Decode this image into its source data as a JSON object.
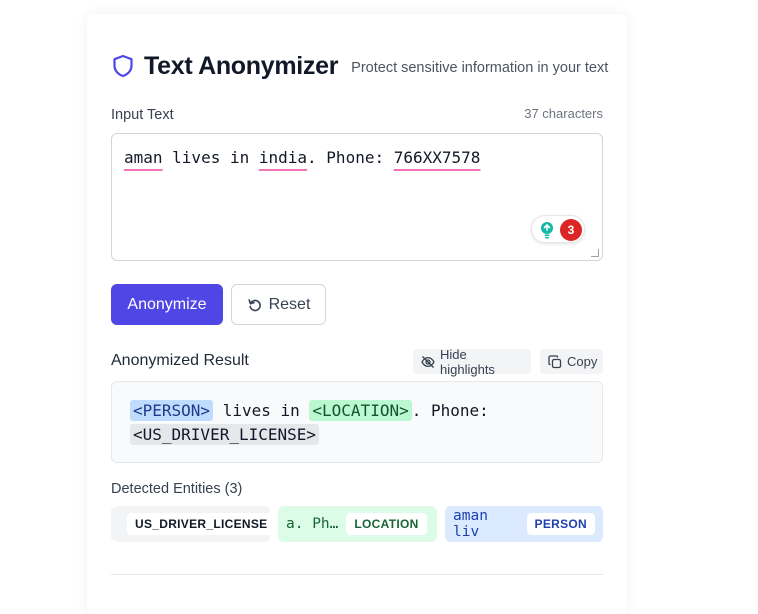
{
  "header": {
    "title": "Text Anonymizer",
    "subtitle": "Protect sensitive information in your text",
    "icon": "shield-icon"
  },
  "input": {
    "label": "Input Text",
    "char_count": "37 characters",
    "segments": [
      "aman",
      " lives in ",
      "india",
      ". Phone: ",
      "766XX7578"
    ]
  },
  "grammarly": {
    "count": "3"
  },
  "actions": {
    "anonymize_label": "Anonymize",
    "reset_label": "Reset"
  },
  "result": {
    "label": "Anonymized Result",
    "hide_label": "Hide highlights",
    "copy_label": "Copy",
    "tag_person": "<PERSON>",
    "text_1": " lives in ",
    "tag_location": "<LOCATION>",
    "text_2": ". Phone:",
    "tag_license": "<US_DRIVER_LICENSE>"
  },
  "entities": {
    "label": "Detected Entities (3)",
    "items": [
      {
        "text": "",
        "type": "US_DRIVER_LICENSE"
      },
      {
        "text": "a. Ph…",
        "type": "LOCATION"
      },
      {
        "text": "aman liv",
        "type": "PERSON"
      }
    ]
  },
  "colors": {
    "accent": "#4f46e5",
    "person": "#bfdbfe",
    "location": "#bbf7d0",
    "license": "#e5e7eb"
  }
}
